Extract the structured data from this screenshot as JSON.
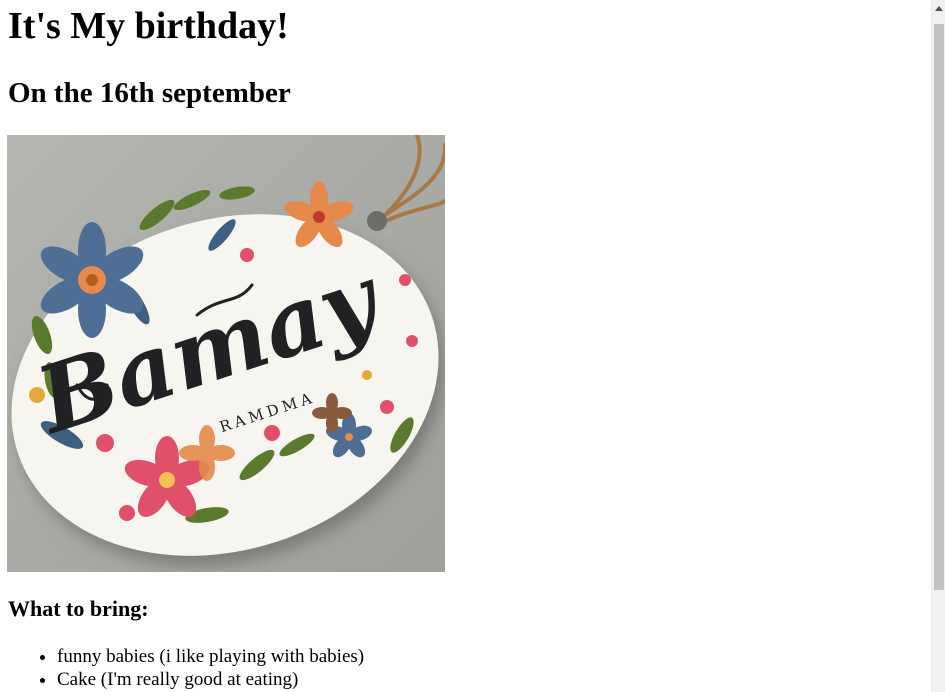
{
  "page": {
    "title": "It's My birthday!",
    "date_line": "On the 16th september"
  },
  "image": {
    "description_icon": "birthday-tag-illustration",
    "tag_text_main": "Bamay",
    "tag_text_sub": "RAMDMA",
    "colors": {
      "background": "#a9aaa6",
      "tag": "#f7f5f0",
      "lettering": "#1f2123",
      "flower_blue": "#4e6e96",
      "flower_orange": "#e58a4a",
      "flower_pink": "#e0506a",
      "leaf_green": "#5c7a2e",
      "string": "#a77a45"
    }
  },
  "bring": {
    "heading": "What to bring:",
    "items": [
      "funny babies (i like playing with babies)",
      "Cake (I'm really good at eating)"
    ]
  },
  "scrollbar": {
    "thumb_color": "#c1c1c1",
    "track_color": "#f1f1f1"
  }
}
